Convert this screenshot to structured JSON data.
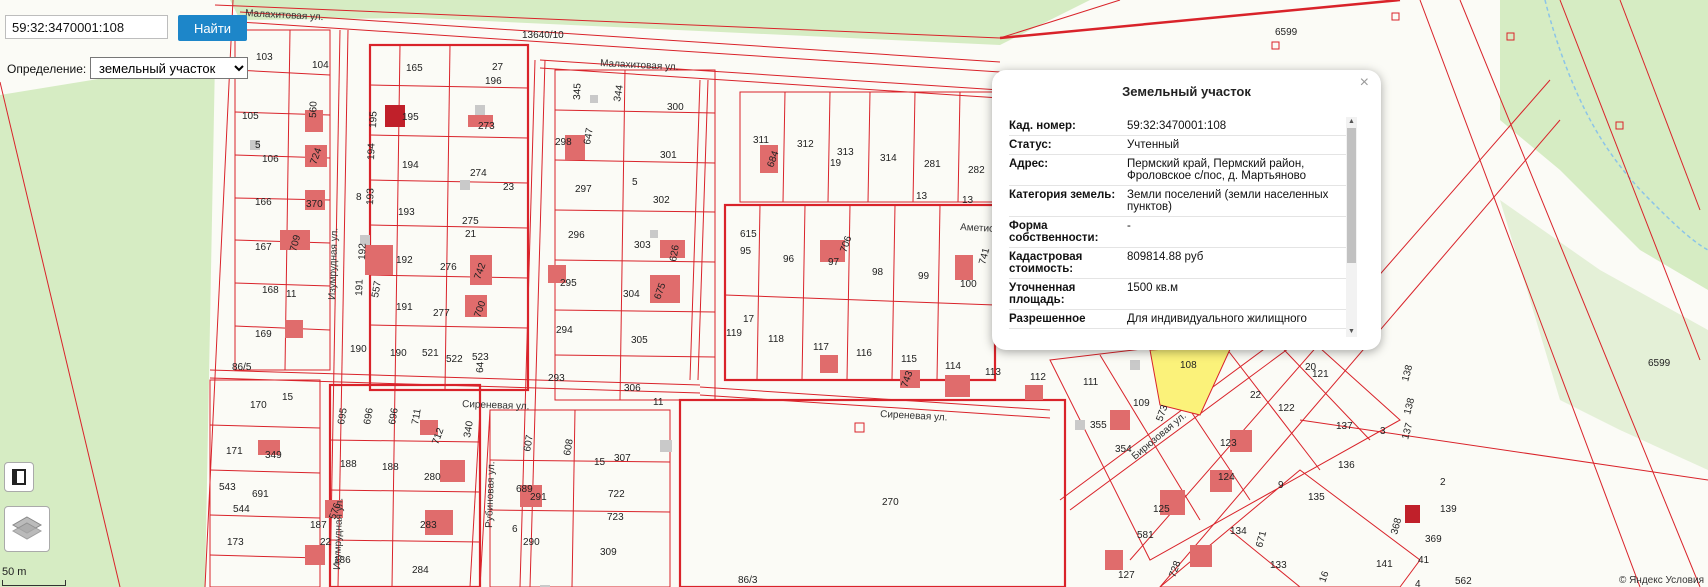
{
  "search": {
    "value": "59:32:3470001:108",
    "button_label": "Найти"
  },
  "definition": {
    "label": "Определение:",
    "selected": "земельный участок"
  },
  "popup": {
    "title": "Земельный участок",
    "close_glyph": "×",
    "rows": [
      {
        "key": "Кад. номер:",
        "value": "59:32:3470001:108"
      },
      {
        "key": "Статус:",
        "value": "Учтенный"
      },
      {
        "key": "Адрес:",
        "value": "Пермский край, Пермский район, Фроловское с/пос, д. Мартьяново"
      },
      {
        "key": "Категория земель:",
        "value": "Земли поселений (земли населенных пунктов)"
      },
      {
        "key": "Форма собственности:",
        "value": "-"
      },
      {
        "key": "Кадастровая стоимость:",
        "value": "809814.88 руб"
      },
      {
        "key": "Уточненная площадь:",
        "value": "1500 кв.м"
      },
      {
        "key": "Разрешенное",
        "value": "Для индивидуального жилищного"
      }
    ]
  },
  "map": {
    "streets": [
      "Малахитовая ул.",
      "Малахитовая ул.",
      "Изумрудная ул.",
      "Сиреневая ул.",
      "Сиреневая ул.",
      "Рубиновая ул.",
      "Изумрудная ул.",
      "Аметистовая ул.",
      "Бирюзовая ул."
    ],
    "codes": [
      "13640/10",
      "6599",
      "6599",
      "86/5",
      "86/3"
    ],
    "parcels_left": [
      "103",
      "104",
      "105",
      "106",
      "166",
      "167",
      "168",
      "169",
      "560",
      "724",
      "370",
      "709",
      "11",
      "5",
      "1"
    ],
    "parcels_mid_left": [
      "165",
      "196",
      "195",
      "273",
      "194",
      "274",
      "193",
      "275",
      "192",
      "276",
      "191",
      "277",
      "190",
      "190",
      "521",
      "522",
      "523",
      "195",
      "194",
      "193",
      "192",
      "191",
      "557",
      "742",
      "700",
      "8",
      "21",
      "23",
      "27",
      "64"
    ],
    "parcels_mid": [
      "345",
      "344",
      "300",
      "298",
      "647",
      "301",
      "297",
      "302",
      "296",
      "303",
      "626",
      "295",
      "304",
      "675",
      "294",
      "305",
      "293",
      "306",
      "5",
      "11"
    ],
    "parcels_right_block": [
      "311",
      "684",
      "312",
      "313",
      "19",
      "314",
      "281",
      "282",
      "13",
      "13",
      "615",
      "95",
      "96",
      "97",
      "706",
      "98",
      "99",
      "100",
      "741",
      "119",
      "17",
      "118",
      "117",
      "116",
      "115",
      "743",
      "114",
      "113",
      "112"
    ],
    "parcels_lower_left": [
      "170",
      "171",
      "349",
      "543",
      "691",
      "544",
      "173",
      "15",
      "695",
      "696",
      "696",
      "711",
      "712",
      "340",
      "188",
      "188",
      "280",
      "576",
      "187",
      "283",
      "186",
      "284",
      "22",
      "607",
      "608",
      "307",
      "689",
      "291",
      "722",
      "723",
      "6",
      "290",
      "309",
      "15",
      "1"
    ],
    "parcels_lower_right": [
      "270",
      "111",
      "109",
      "573",
      "355",
      "354",
      "108",
      "121",
      "122",
      "138",
      "137",
      "123",
      "136",
      "124",
      "125",
      "135",
      "134",
      "671",
      "138",
      "137",
      "2",
      "139",
      "368",
      "369",
      "141",
      "581",
      "127",
      "728",
      "133",
      "562",
      "3",
      "4",
      "20",
      "22",
      "41",
      "9",
      "16"
    ],
    "copyright": "© Яндекс  Условия"
  },
  "scale": {
    "label": "50 m"
  },
  "colors": {
    "parcel_line": "#d9232a",
    "forest": "#d6ecc3",
    "selected_parcel": "#fbf27a",
    "building": "#e06c6c",
    "button": "#1d86c9"
  }
}
